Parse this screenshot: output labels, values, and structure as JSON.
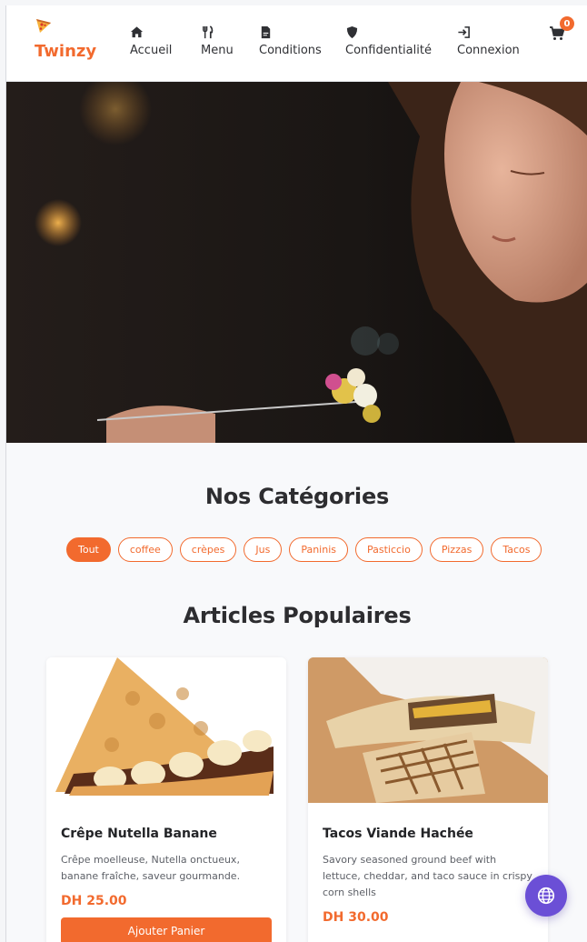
{
  "brand": {
    "name": "Twinzy",
    "logo_icon": "pizza-icon"
  },
  "nav": {
    "items": [
      {
        "label": "Accueil",
        "icon": "home-icon"
      },
      {
        "label": "Menu",
        "icon": "utensils-icon"
      },
      {
        "label": "Conditions",
        "icon": "document-icon"
      },
      {
        "label": "Confidentialité",
        "icon": "shield-icon"
      },
      {
        "label": "Connexion",
        "icon": "login-icon"
      }
    ],
    "cart": {
      "icon": "cart-icon",
      "count": "0"
    }
  },
  "categories": {
    "title": "Nos Catégories",
    "chips": [
      "Tout",
      "coffee",
      "crèpes",
      "Jus",
      "Paninis",
      "Pasticcio",
      "Pizzas",
      "Tacos"
    ],
    "active": "Tout"
  },
  "popular": {
    "title": "Articles Populaires",
    "items": [
      {
        "name": "Crêpe Nutella Banane",
        "desc": "Crêpe moelleuse, Nutella onctueux, banane fraîche, saveur gourmande.",
        "price": "DH 25.00",
        "button": "Ajouter Panier"
      },
      {
        "name": "Tacos Viande Hachée",
        "desc": "Savory seasoned ground beef with lettuce, cheddar, and taco sauce in crispy corn shells",
        "price": "DH 30.00"
      }
    ]
  },
  "colors": {
    "accent": "#f26a2e",
    "fab": "#6b4fd6"
  },
  "fab": {
    "icon": "globe-icon"
  }
}
